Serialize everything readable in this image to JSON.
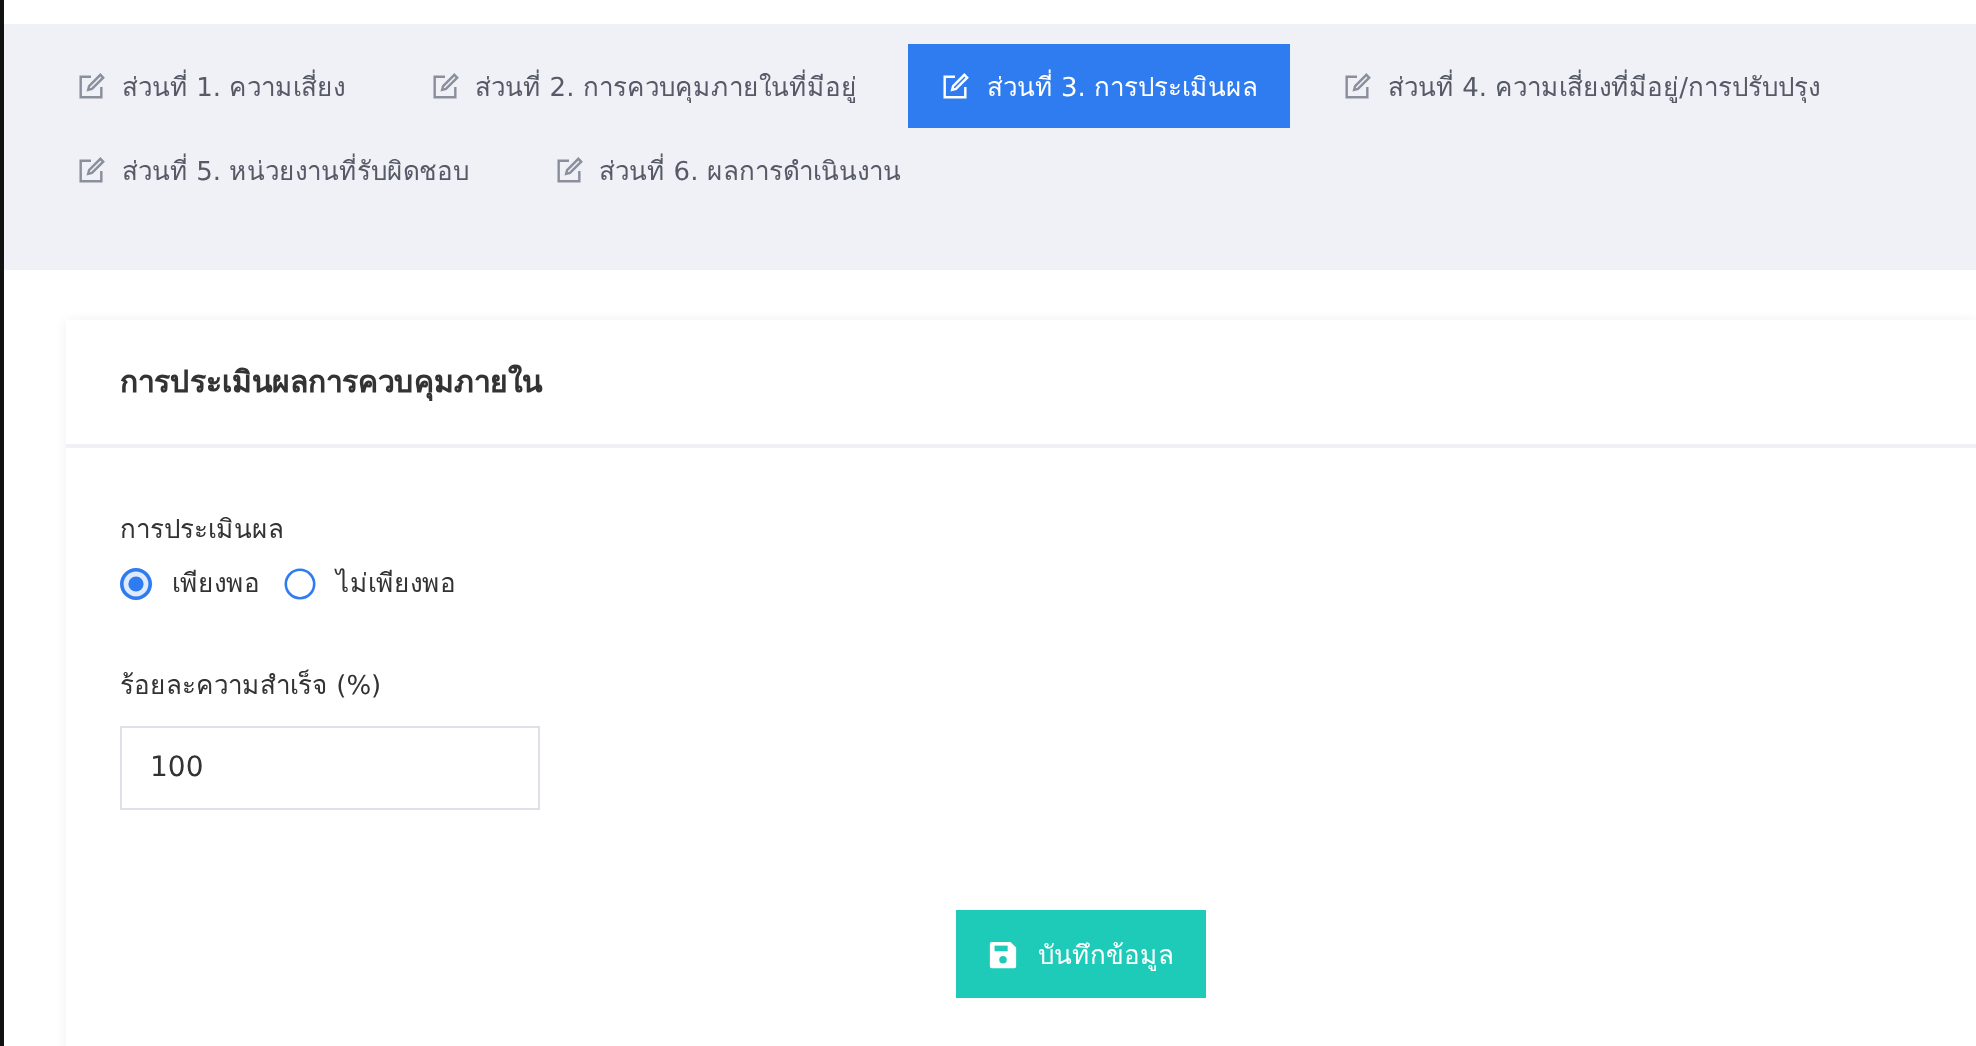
{
  "tabs": [
    {
      "label": "ส่วนที่ 1. ความเสี่ยง",
      "selected": false
    },
    {
      "label": "ส่วนที่ 2. การควบคุมภายในที่มีอยู่",
      "selected": false
    },
    {
      "label": "ส่วนที่ 3. การประเมินผล",
      "selected": true
    },
    {
      "label": "ส่วนที่ 4. ความเสี่ยงที่มีอยู่/การปรับปรุง",
      "selected": false
    },
    {
      "label": "ส่วนที่ 5. หน่วยงานที่รับผิดชอบ",
      "selected": false
    },
    {
      "label": "ส่วนที่ 6. ผลการดำเนินงาน",
      "selected": false
    }
  ],
  "card": {
    "title": "การประเมินผลการควบคุมภายใน",
    "evaluation": {
      "label": "การประเมินผล",
      "options": [
        {
          "label": "เพียงพอ",
          "selected": true
        },
        {
          "label": "ไม่เพียงพอ",
          "selected": false
        }
      ]
    },
    "success_rate": {
      "label": "ร้อยละความสำเร็จ (%)",
      "value": "100"
    },
    "save_button": "บันทึกข้อมูล"
  }
}
